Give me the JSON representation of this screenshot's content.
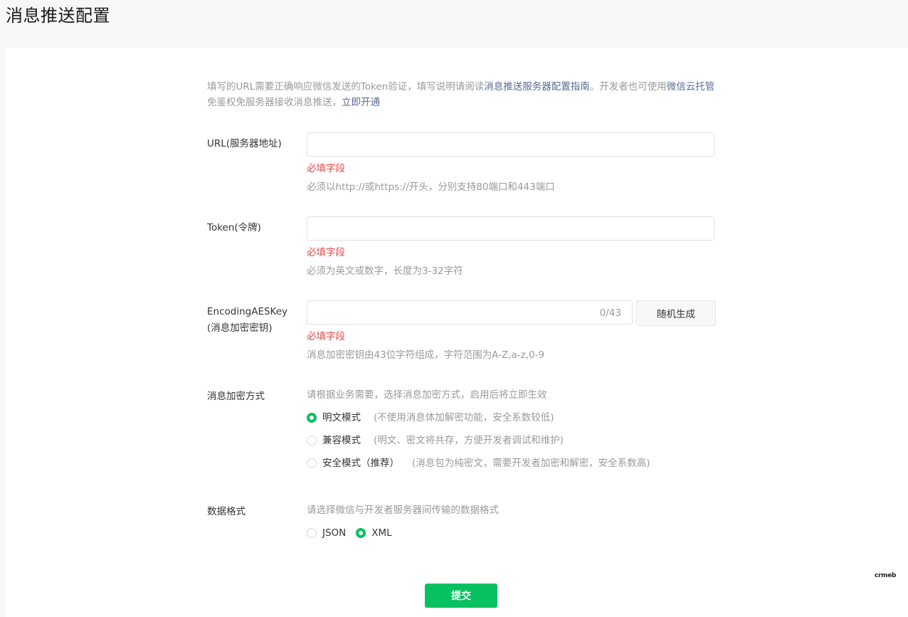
{
  "page": {
    "title": "消息推送配置"
  },
  "intro": {
    "text1": "填写的URL需要正确响应微信发送的Token验证，填写说明请阅读",
    "link1": "消息推送服务器配置指南",
    "text2": "。开发者也可使用",
    "link2": "微信云托管",
    "text3": "免鉴权免服务器接收消息推送，",
    "link3": "立即开通"
  },
  "url_field": {
    "label": "URL(服务器地址)",
    "value": "",
    "error": "必填字段",
    "hint": "必须以http://或https://开头，分别支持80端口和443端口"
  },
  "token_field": {
    "label": "Token(令牌)",
    "value": "",
    "error": "必填字段",
    "hint": "必须为英文或数字，长度为3-32字符"
  },
  "aes_field": {
    "label_line1": "EncodingAESKey",
    "label_line2": "(消息加密密钥)",
    "value": "",
    "counter": "0/43",
    "random_button": "随机生成",
    "error": "必填字段",
    "hint": "消息加密密钥由43位字符组成，字符范围为A-Z,a-z,0-9"
  },
  "encrypt_mode": {
    "label": "消息加密方式",
    "hint": "请根据业务需要，选择消息加密方式，启用后将立即生效",
    "options": [
      {
        "label": "明文模式",
        "desc": "(不使用消息体加解密功能，安全系数较低)",
        "checked": true
      },
      {
        "label": "兼容模式",
        "desc": "(明文、密文将共存，方便开发者调试和维护)",
        "checked": false
      },
      {
        "label": "安全模式（推荐）",
        "desc": "(消息包为纯密文，需要开发者加密和解密，安全系数高)",
        "checked": false
      }
    ]
  },
  "data_format": {
    "label": "数据格式",
    "hint": "请选择微信与开发者服务器间传输的数据格式",
    "options": [
      {
        "label": "JSON",
        "checked": false
      },
      {
        "label": "XML",
        "checked": true
      }
    ]
  },
  "submit_label": "提交",
  "watermark": "crmeb",
  "colors": {
    "accent": "#07c160",
    "link": "#576b95",
    "error": "#e04b4b"
  }
}
